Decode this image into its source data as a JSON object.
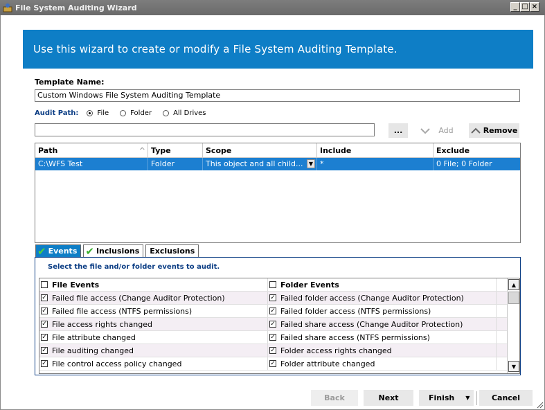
{
  "window": {
    "title": "File System Auditing Wizard",
    "buttons": [
      "_",
      "□",
      "×"
    ]
  },
  "banner": {
    "text": "Use this wizard to create or modify a File System Auditing Template."
  },
  "template": {
    "label": "Template Name:",
    "value": "Custom Windows File System Auditing Template"
  },
  "audit_path": {
    "label": "Audit Path:",
    "options": [
      {
        "label": "File",
        "selected": true
      },
      {
        "label": "Folder",
        "selected": false
      },
      {
        "label": "All Drives",
        "selected": false
      }
    ],
    "value": ""
  },
  "toolbar": {
    "browse_label": "...",
    "add_label": "Add",
    "remove_label": "Remove"
  },
  "grid": {
    "columns": [
      "Path",
      "Type",
      "Scope",
      "Include",
      "Exclude"
    ],
    "rows": [
      {
        "path": "C:\\WFS Test",
        "type": "Folder",
        "scope": "This object and all child...",
        "include": "*",
        "exclude": "0 File; 0 Folder"
      }
    ]
  },
  "tabs": [
    {
      "label": "Events",
      "checked": true,
      "active": true
    },
    {
      "label": "Inclusions",
      "checked": true,
      "active": false
    },
    {
      "label": "Exclusions",
      "checked": false,
      "active": false
    }
  ],
  "events_panel": {
    "caption": "Select the file and/or folder events to audit.",
    "file_header": "File Events",
    "folder_header": "Folder Events",
    "file_events": [
      "Failed file access (Change Auditor Protection)",
      "Failed file access (NTFS permissions)",
      "File access rights changed",
      "File attribute changed",
      "File auditing changed",
      "File control access policy changed"
    ],
    "folder_events": [
      "Failed folder access (Change Auditor Protection)",
      "Failed folder access (NTFS permissions)",
      "Failed share access (Change Auditor Protection)",
      "Failed share access (NTFS permissions)",
      "Folder access rights changed",
      "Folder attribute changed"
    ]
  },
  "footer": {
    "back_label": "Back",
    "next_label": "Next",
    "finish_label": "Finish",
    "cancel_label": "Cancel"
  },
  "colors": {
    "banner": "#0e7ec6",
    "selection": "#1c7fd1",
    "active_tab": "#0e7ec6",
    "check_green": "#38b02c"
  }
}
